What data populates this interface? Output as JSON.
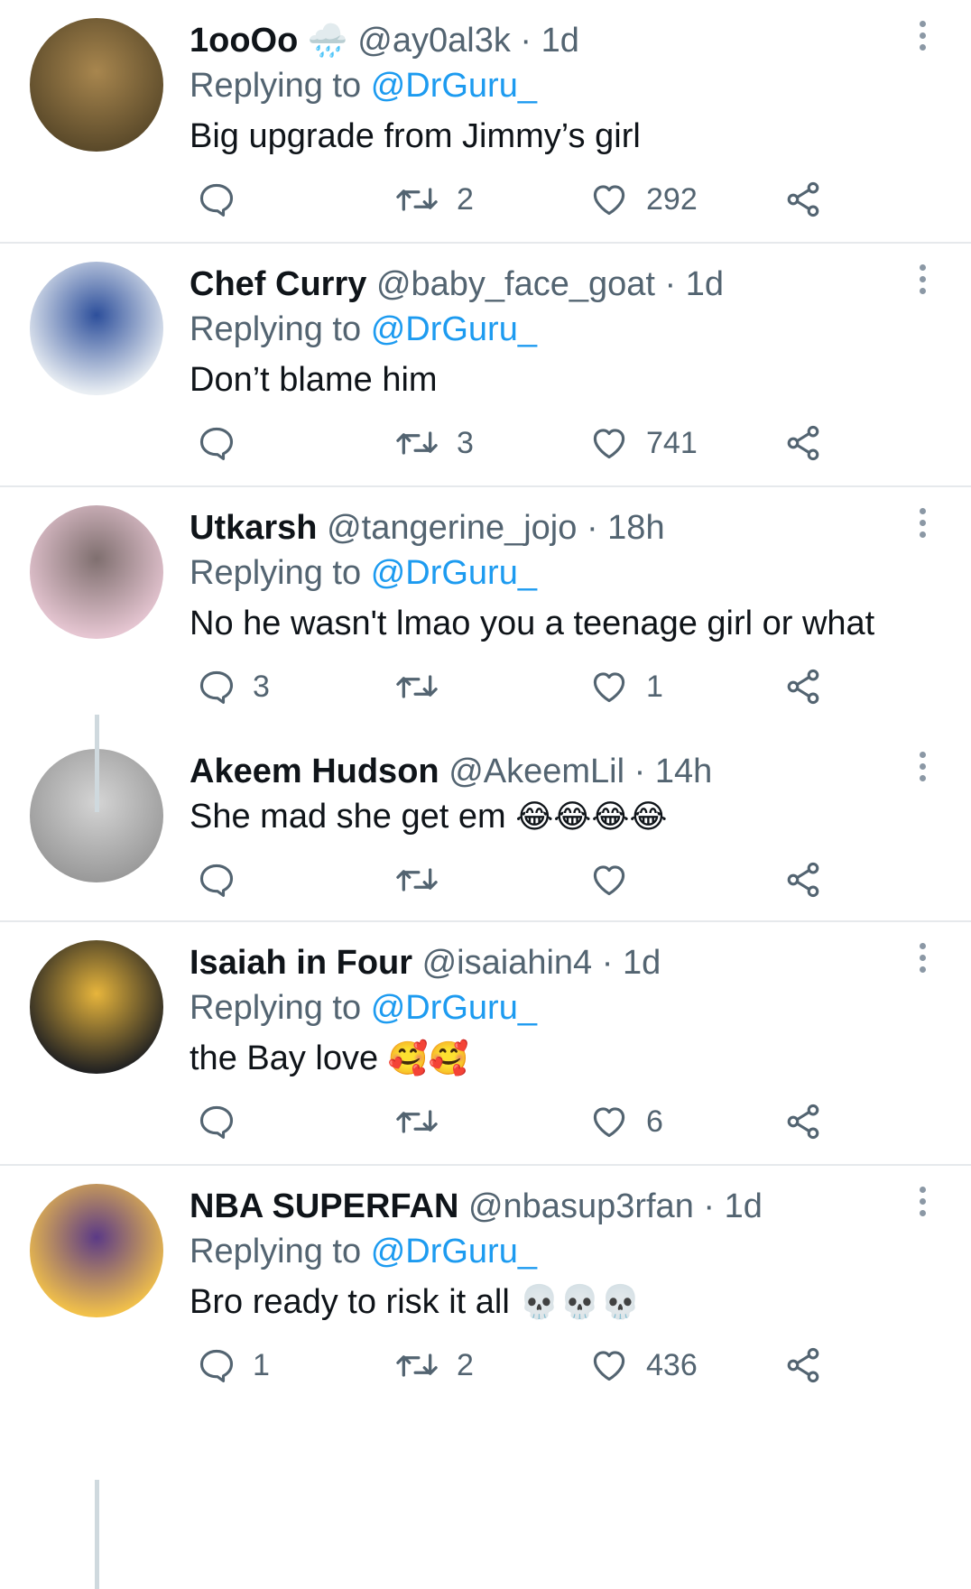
{
  "tweets": [
    {
      "name": "1ooOo",
      "name_emoji": "🌧️",
      "handle": "@ay0al3k",
      "time": "1d",
      "replying_label": "Replying to",
      "replying_to": "@DrGuru_",
      "text": "Big upgrade from Jimmy’s girl",
      "text_emoji": "",
      "replies": "",
      "retweets": "2",
      "likes": "292",
      "avatar_colors": [
        "#5b4a2a",
        "#a8864e"
      ]
    },
    {
      "name": "Chef Curry",
      "name_emoji": "",
      "handle": "@baby_face_goat",
      "time": "1d",
      "replying_label": "Replying to",
      "replying_to": "@DrGuru_",
      "text": "Don’t blame him",
      "text_emoji": "",
      "replies": "",
      "retweets": "3",
      "likes": "741",
      "avatar_colors": [
        "#e9eef3",
        "#2d4f9b"
      ]
    },
    {
      "name": "Utkarsh",
      "name_emoji": "",
      "handle": "@tangerine_jojo",
      "time": "18h",
      "replying_label": "Replying to",
      "replying_to": "@DrGuru_",
      "text": "No he wasn't lmao you a teenage girl or what",
      "text_emoji": "",
      "replies": "3",
      "retweets": "",
      "likes": "1",
      "avatar_colors": [
        "#e6c6d2",
        "#7f6f6f"
      ]
    },
    {
      "name": "Akeem Hudson",
      "name_emoji": "",
      "handle": "@AkeemLil",
      "time": "14h",
      "replying_label": "",
      "replying_to": "",
      "text": "She mad she get em",
      "text_emoji": "😂😂😂😂",
      "replies": "",
      "retweets": "",
      "likes": "",
      "avatar_colors": [
        "#9a9a9a",
        "#d4d4d4"
      ]
    },
    {
      "name": "Isaiah in Four",
      "name_emoji": "",
      "handle": "@isaiahin4",
      "time": "1d",
      "replying_label": "Replying to",
      "replying_to": "@DrGuru_",
      "text": "the Bay love",
      "text_emoji": "🥰🥰",
      "replies": "",
      "retweets": "",
      "likes": "6",
      "avatar_colors": [
        "#222222",
        "#e7b53c"
      ]
    },
    {
      "name": "NBA SUPERFAN",
      "name_emoji": "",
      "handle": "@nbasup3rfan",
      "time": "1d",
      "replying_label": "Replying to",
      "replying_to": "@DrGuru_",
      "text": "Bro ready to risk it all",
      "text_emoji": "💀💀💀",
      "replies": "1",
      "retweets": "2",
      "likes": "436",
      "avatar_colors": [
        "#f2c14a",
        "#5b3a86"
      ]
    }
  ],
  "colors": {
    "accent": "#1d9bf0",
    "muted": "#536471",
    "divider": "#e6e9ec"
  },
  "icons": [
    "reply-icon",
    "retweet-icon",
    "like-icon",
    "share-icon",
    "more-icon"
  ]
}
